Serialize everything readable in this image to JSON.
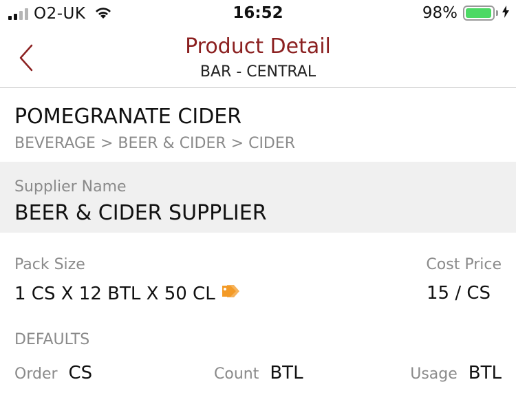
{
  "status_bar": {
    "carrier": "O2-UK",
    "time": "16:52",
    "battery_percent": "98%",
    "battery_level": 0.98,
    "signal_bars_total": 4,
    "signal_bars_active": 2,
    "colors": {
      "battery_fill": "#4cd964",
      "signal_active": "#111111",
      "signal_inactive": "#b5b5b5"
    }
  },
  "nav": {
    "back_icon": "chevron-left-icon",
    "title": "Product Detail",
    "subtitle": "BAR - CENTRAL",
    "colors": {
      "accent": "#8b2020"
    }
  },
  "product": {
    "name": "POMEGRANATE CIDER",
    "category_path": "BEVERAGE > BEER & CIDER > CIDER"
  },
  "supplier": {
    "label": "Supplier Name",
    "value": "BEER & CIDER SUPPLIER"
  },
  "pack": {
    "label": "Pack Size",
    "value": "1 CS X 12 BTL X 50 CL",
    "tag_icon": "price-tag-icon",
    "tag_color": "#f39a26"
  },
  "cost": {
    "label": "Cost Price",
    "value": "15 / CS"
  },
  "defaults": {
    "heading": "DEFAULTS",
    "order_label": "Order",
    "order_value": "CS",
    "count_label": "Count",
    "count_value": "BTL",
    "usage_label": "Usage",
    "usage_value": "BTL"
  }
}
